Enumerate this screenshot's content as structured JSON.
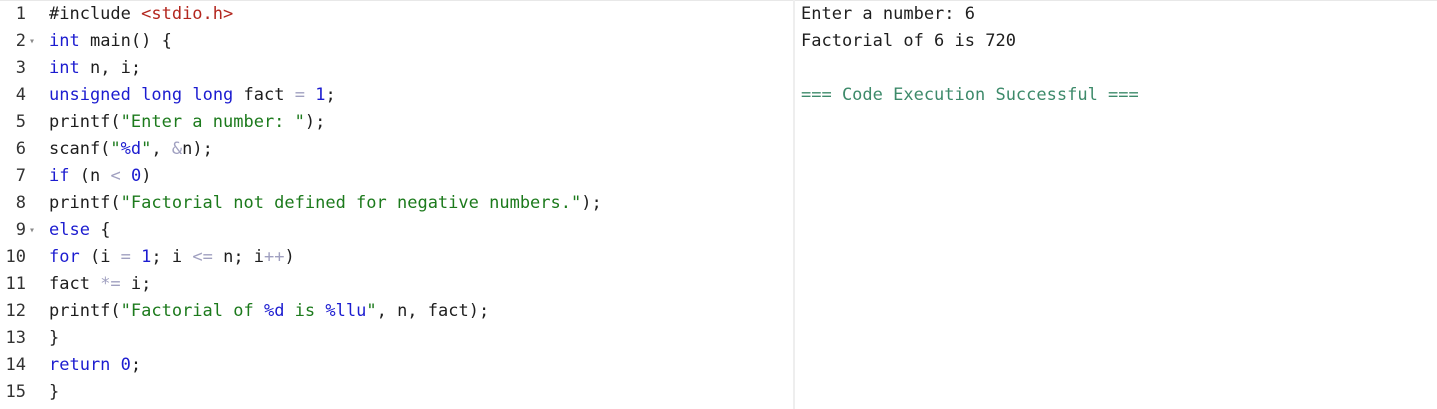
{
  "editor": {
    "lines": [
      {
        "num": "1",
        "fold": "",
        "tokens": [
          {
            "t": "#include ",
            "c": "plain"
          },
          {
            "t": "<stdio.h>",
            "c": "pp"
          }
        ]
      },
      {
        "num": "2",
        "fold": "▾",
        "tokens": [
          {
            "t": "int",
            "c": "kw"
          },
          {
            "t": " main() {",
            "c": "plain"
          }
        ]
      },
      {
        "num": "3",
        "fold": "",
        "tokens": [
          {
            "t": "int",
            "c": "kw"
          },
          {
            "t": " n, i;",
            "c": "plain"
          }
        ]
      },
      {
        "num": "4",
        "fold": "",
        "tokens": [
          {
            "t": "unsigned",
            "c": "kw"
          },
          {
            "t": " ",
            "c": "plain"
          },
          {
            "t": "long",
            "c": "kw"
          },
          {
            "t": " ",
            "c": "plain"
          },
          {
            "t": "long",
            "c": "kw"
          },
          {
            "t": " fact ",
            "c": "plain"
          },
          {
            "t": "=",
            "c": "op"
          },
          {
            "t": " ",
            "c": "plain"
          },
          {
            "t": "1",
            "c": "num"
          },
          {
            "t": ";",
            "c": "plain"
          }
        ]
      },
      {
        "num": "5",
        "fold": "",
        "tokens": [
          {
            "t": "printf(",
            "c": "plain"
          },
          {
            "t": "\"Enter a number: \"",
            "c": "str"
          },
          {
            "t": ");",
            "c": "plain"
          }
        ]
      },
      {
        "num": "6",
        "fold": "",
        "tokens": [
          {
            "t": "scanf(",
            "c": "plain"
          },
          {
            "t": "\"",
            "c": "str"
          },
          {
            "t": "%d",
            "c": "kw"
          },
          {
            "t": "\"",
            "c": "str"
          },
          {
            "t": ", ",
            "c": "plain"
          },
          {
            "t": "&",
            "c": "op"
          },
          {
            "t": "n);",
            "c": "plain"
          }
        ]
      },
      {
        "num": "7",
        "fold": "",
        "tokens": [
          {
            "t": "if",
            "c": "kw"
          },
          {
            "t": " (n ",
            "c": "plain"
          },
          {
            "t": "<",
            "c": "op"
          },
          {
            "t": " ",
            "c": "plain"
          },
          {
            "t": "0",
            "c": "num"
          },
          {
            "t": ")",
            "c": "plain"
          }
        ]
      },
      {
        "num": "8",
        "fold": "",
        "tokens": [
          {
            "t": "printf(",
            "c": "plain"
          },
          {
            "t": "\"Factorial not defined for negative numbers.\"",
            "c": "str"
          },
          {
            "t": ");",
            "c": "plain"
          }
        ]
      },
      {
        "num": "9",
        "fold": "▾",
        "tokens": [
          {
            "t": "else",
            "c": "kw"
          },
          {
            "t": " {",
            "c": "plain"
          }
        ]
      },
      {
        "num": "10",
        "fold": "",
        "tokens": [
          {
            "t": "for",
            "c": "kw"
          },
          {
            "t": " (i ",
            "c": "plain"
          },
          {
            "t": "=",
            "c": "op"
          },
          {
            "t": " ",
            "c": "plain"
          },
          {
            "t": "1",
            "c": "num"
          },
          {
            "t": "; i ",
            "c": "plain"
          },
          {
            "t": "<=",
            "c": "op"
          },
          {
            "t": " n; i",
            "c": "plain"
          },
          {
            "t": "++",
            "c": "op"
          },
          {
            "t": ")",
            "c": "plain"
          }
        ]
      },
      {
        "num": "11",
        "fold": "",
        "tokens": [
          {
            "t": "fact ",
            "c": "plain"
          },
          {
            "t": "*=",
            "c": "op"
          },
          {
            "t": " i;",
            "c": "plain"
          }
        ]
      },
      {
        "num": "12",
        "fold": "",
        "tokens": [
          {
            "t": "printf(",
            "c": "plain"
          },
          {
            "t": "\"Factorial of ",
            "c": "str"
          },
          {
            "t": "%d",
            "c": "kw"
          },
          {
            "t": " is ",
            "c": "str"
          },
          {
            "t": "%llu",
            "c": "kw"
          },
          {
            "t": "\"",
            "c": "str"
          },
          {
            "t": ", n, fact);",
            "c": "plain"
          }
        ]
      },
      {
        "num": "13",
        "fold": "",
        "tokens": [
          {
            "t": "}",
            "c": "plain"
          }
        ]
      },
      {
        "num": "14",
        "fold": "",
        "tokens": [
          {
            "t": "return",
            "c": "kw"
          },
          {
            "t": " ",
            "c": "plain"
          },
          {
            "t": "0",
            "c": "num"
          },
          {
            "t": ";",
            "c": "plain"
          }
        ]
      },
      {
        "num": "15",
        "fold": "",
        "tokens": [
          {
            "t": "}",
            "c": "plain"
          }
        ]
      }
    ]
  },
  "output": {
    "lines": [
      {
        "text": "Enter a number: 6",
        "kind": "normal"
      },
      {
        "text": "Factorial of 6 is 720",
        "kind": "normal"
      },
      {
        "text": "",
        "kind": "normal"
      },
      {
        "text": "=== Code Execution Successful ===",
        "kind": "success"
      }
    ]
  },
  "colors": {
    "keyword": "#1c1cd0",
    "string": "#1c7a1c",
    "preprocessor": "#b3261e",
    "operator": "#a0a0c0",
    "success": "#3d8a6a"
  }
}
